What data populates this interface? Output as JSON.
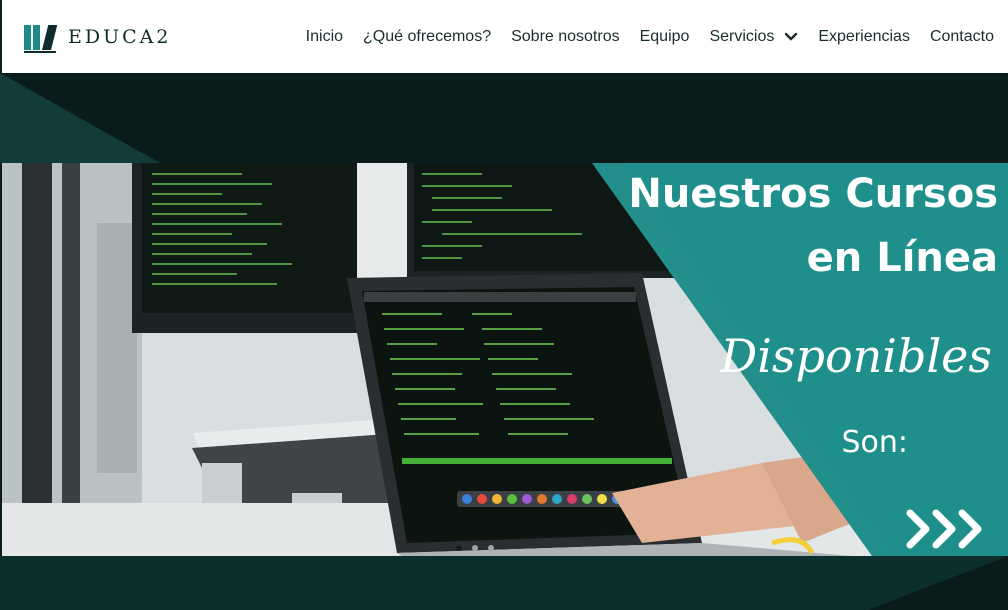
{
  "brand": {
    "name": "EDUCA2"
  },
  "nav": {
    "items": [
      {
        "label": "Inicio"
      },
      {
        "label": "¿Qué ofrecemos?"
      },
      {
        "label": "Sobre nosotros"
      },
      {
        "label": "Equipo"
      },
      {
        "label": "Servicios",
        "has_dropdown": true
      },
      {
        "label": "Experiencias"
      },
      {
        "label": "Contacto"
      }
    ]
  },
  "hero": {
    "line1": "Nuestros Cursos",
    "line2": "en Línea",
    "line3": "Disponibles",
    "line4": "Son:",
    "arrow_icon": "triple-chevron-right-icon",
    "slides_total": 3,
    "active_slide": 1
  },
  "colors": {
    "teal": "#1f8f8b",
    "dark": "#0a1b1b",
    "dark_teal": "#0c2f2d"
  }
}
